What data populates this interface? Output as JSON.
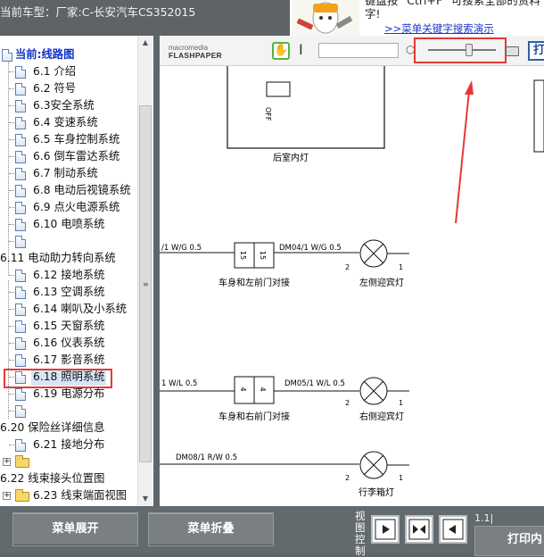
{
  "header": {
    "model_label": "当前车型：厂家:C-长安汽车CS352015",
    "help_text_line1": "键盘按 \"Ctrl+F\" 可搜索全部的资料",
    "help_text_line2": "字!",
    "help_link": ">>菜单关键字搜索演示"
  },
  "tree": {
    "root_label": "当前:线路图",
    "items": [
      {
        "label": "6.1 介绍"
      },
      {
        "label": "6.2 符号"
      },
      {
        "label": "6.3安全系统"
      },
      {
        "label": "6.4 变速系统"
      },
      {
        "label": "6.5 车身控制系统"
      },
      {
        "label": "6.6 倒车雷达系统"
      },
      {
        "label": "6.7 制动系统"
      },
      {
        "label": "6.8 电动后视镜系统"
      },
      {
        "label": "6.9 点火电源系统"
      },
      {
        "label": "6.10 电喷系统"
      },
      {
        "label": ""
      },
      {
        "label": "6.11 电动助力转向系统"
      },
      {
        "label": "6.12 接地系统"
      },
      {
        "label": "6.13 空调系统"
      },
      {
        "label": "6.14 喇叭及小系统"
      },
      {
        "label": "6.15 天窗系统"
      },
      {
        "label": "6.16 仪表系统"
      },
      {
        "label": "6.17 影音系统"
      },
      {
        "label": "6.18 照明系统"
      },
      {
        "label": "6.19 电源分布"
      },
      {
        "label": ""
      },
      {
        "label": "6.20 保险丝详细信息"
      },
      {
        "label": "6.21 接地分布"
      },
      {
        "label": ""
      },
      {
        "label": "6.22 线束接头位置图"
      },
      {
        "label": "6.23 线束端面视图"
      }
    ]
  },
  "viewer": {
    "logo_line1": "macromedia",
    "logo_line2": "FLASHPAPER",
    "print_short": "打",
    "zoom_level": 0.62
  },
  "diagram": {
    "rear_lamp": "后室内灯",
    "off": "OFF",
    "wire1": "/1 W/G 0.5",
    "dm04": "DM04/1 W/G 0.5",
    "conn15_label": "车身和左前门对接",
    "left_lamp": "左侧迎宾灯",
    "conn15a": "15",
    "conn15b": "15",
    "wire2": "1 W/L 0.5",
    "dm05": "DM05/1 W/L 0.5",
    "conn4_label": "车身和右前门对接",
    "right_lamp": "右侧迎宾灯",
    "conn4a": "4",
    "conn4b": "4",
    "dm08": "DM08/1 R/W 0.5",
    "trunk_lamp": "行李箱灯",
    "pin2": "2",
    "pin1": "1"
  },
  "bottom": {
    "expand_label": "菜单展开",
    "collapse_label": "菜单折叠",
    "view_ctrl_label": "视图控制",
    "version": "1.1|",
    "print_label": "打印内"
  }
}
